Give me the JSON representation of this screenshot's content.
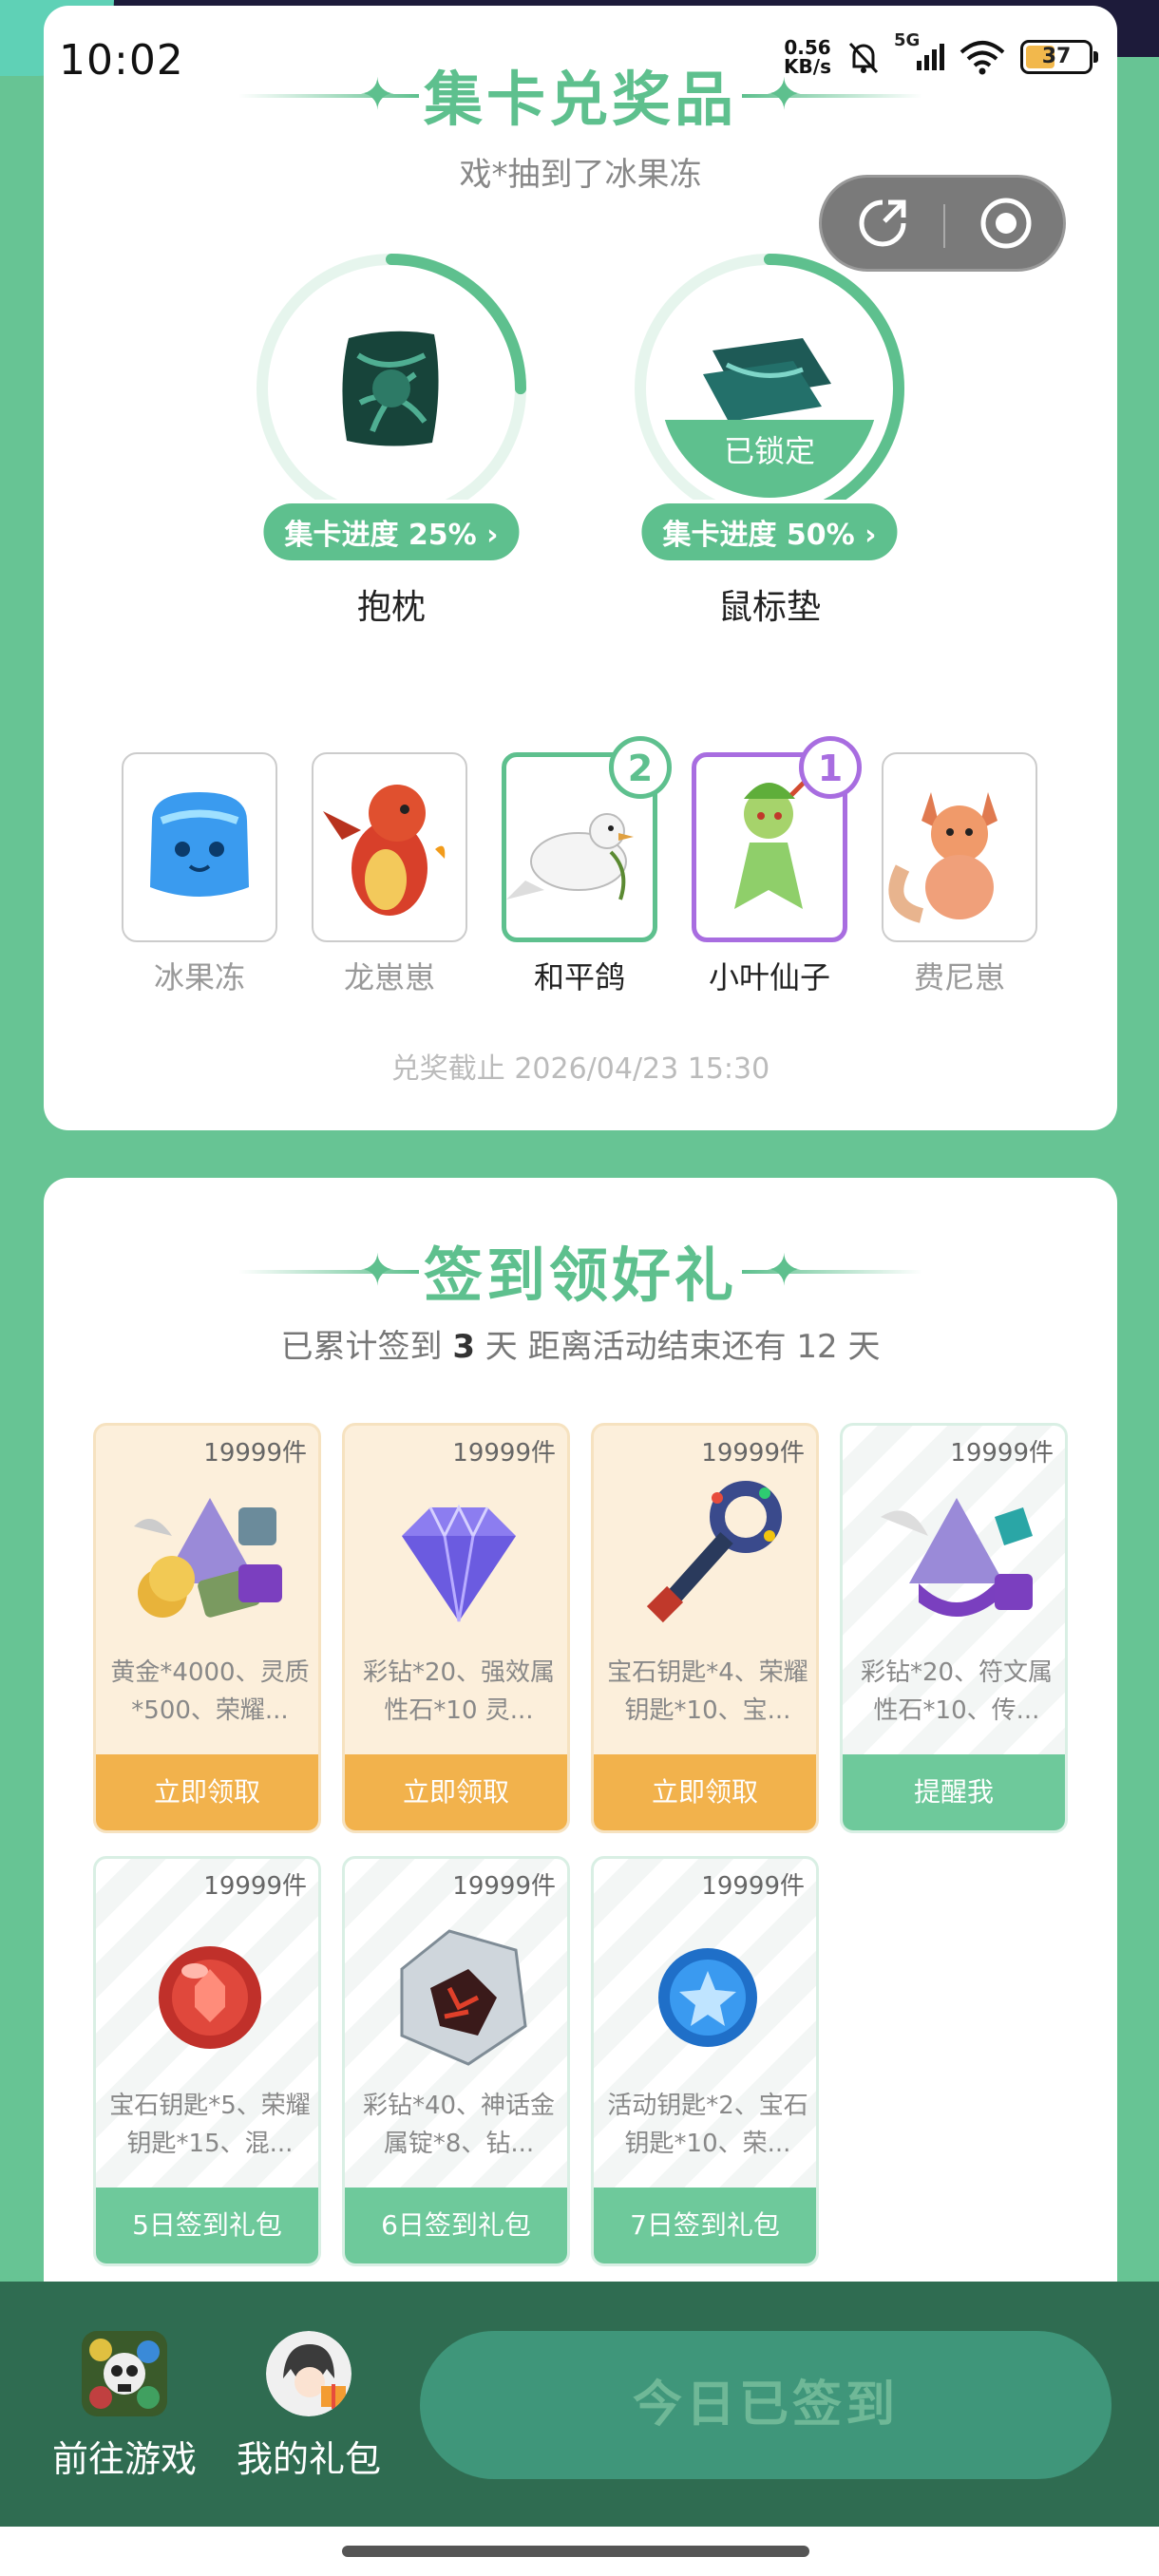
{
  "status_bar": {
    "time": "10:02",
    "net_speed_value": "0.56",
    "net_speed_unit": "KB/s",
    "network": "5G",
    "battery": "37"
  },
  "collect": {
    "title": "集卡兑奖品",
    "notice": "戏*抽到了冰果冻",
    "prizes": [
      {
        "name": "抱枕",
        "progress_label": "集卡进度 25%",
        "progress": 0.25,
        "locked_label": ""
      },
      {
        "name": "鼠标垫",
        "progress_label": "集卡进度 50%",
        "progress": 0.5,
        "locked_label": "已锁定"
      }
    ],
    "characters": [
      {
        "name": "冰果冻",
        "count": ""
      },
      {
        "name": "龙崽崽",
        "count": ""
      },
      {
        "name": "和平鸽",
        "count": "2"
      },
      {
        "name": "小叶仙子",
        "count": "1"
      },
      {
        "name": "费尼崽",
        "count": ""
      }
    ],
    "deadline": "兑奖截止 2026/04/23 15:30"
  },
  "signin": {
    "title": "签到领好礼",
    "summary_prefix": "已累计签到",
    "days": "3",
    "summary_mid": "天  距离活动结束还有 12 天",
    "gifts": [
      {
        "qty": "19999件",
        "desc": "黄金*4000、灵质*500、荣耀...",
        "action": "立即领取"
      },
      {
        "qty": "19999件",
        "desc": "彩钻*20、强效属性石*10 灵...",
        "action": "立即领取"
      },
      {
        "qty": "19999件",
        "desc": "宝石钥匙*4、荣耀钥匙*10、宝...",
        "action": "立即领取"
      },
      {
        "qty": "19999件",
        "desc": "彩钻*20、符文属性石*10、传...",
        "action": "提醒我"
      },
      {
        "qty": "19999件",
        "desc": "宝石钥匙*5、荣耀钥匙*15、混...",
        "action": "5日签到礼包"
      },
      {
        "qty": "19999件",
        "desc": "彩钻*40、神话金属锭*8、钻...",
        "action": "6日签到礼包"
      },
      {
        "qty": "19999件",
        "desc": "活动钥匙*2、宝石钥匙*10、荣...",
        "action": "7日签到礼包"
      }
    ]
  },
  "bottom": {
    "go_game": "前往游戏",
    "my_gifts": "我的礼包",
    "signed_button": "今日已签到"
  },
  "colors": {
    "accent": "#5ec08e",
    "claim": "#f2b24c",
    "purple": "#a86de0",
    "bar": "#2f6c51"
  }
}
